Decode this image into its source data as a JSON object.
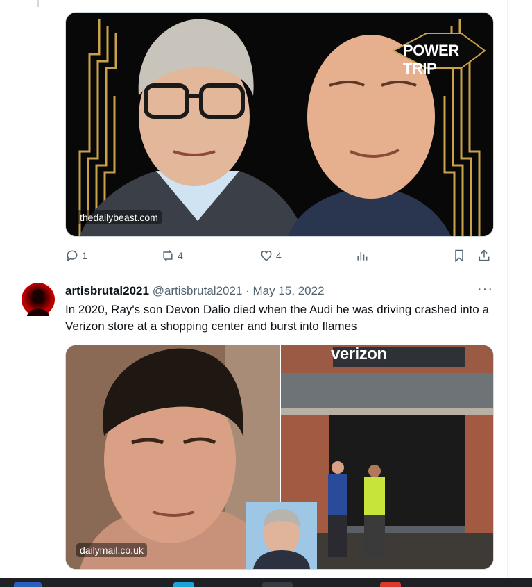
{
  "first_tweet": {
    "image": {
      "badge_text": "POWER TRIP",
      "watermark": "thedailybeast.com"
    },
    "actions": {
      "replies": "1",
      "retweets": "4",
      "likes": "4"
    }
  },
  "second_tweet": {
    "display_name": "artisbrutal2021",
    "handle": "@artisbrutal2021",
    "separator": " · ",
    "date": "May 15, 2022",
    "more": "···",
    "text": "In 2020, Ray's son Devon Dalio died when the Audi he was driving crashed into a Verizon store at a shopping center and burst into flames",
    "image": {
      "store_sign": "verizon",
      "watermark": "dailymail.co.uk"
    }
  },
  "colors": {
    "text_primary": "#0f1419",
    "text_secondary": "#536471",
    "border": "#cfd9de",
    "gold": "#c9a24a",
    "verizon_red": "#cd040b"
  },
  "icons": [
    "reply-icon",
    "retweet-icon",
    "like-icon",
    "views-icon",
    "bookmark-icon",
    "share-icon",
    "more-icon"
  ]
}
